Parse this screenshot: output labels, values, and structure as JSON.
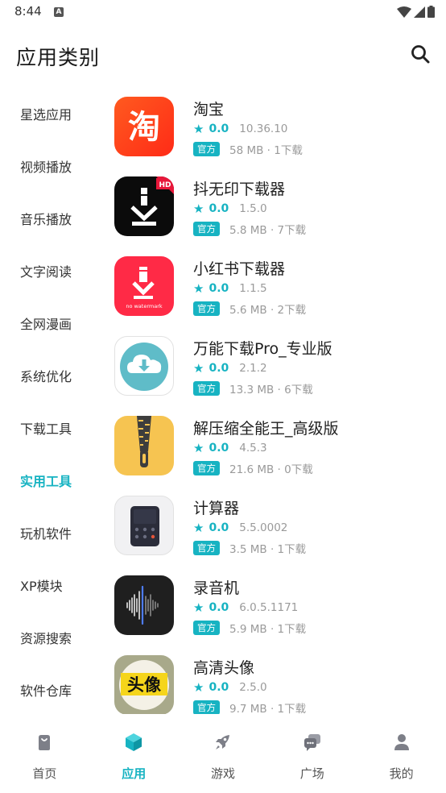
{
  "status_bar": {
    "time": "8:44",
    "notification_icon": "A"
  },
  "header": {
    "title": "应用类别",
    "search_icon": "search-icon"
  },
  "categories": [
    {
      "label": "星选应用",
      "active": false
    },
    {
      "label": "视频播放",
      "active": false
    },
    {
      "label": "音乐播放",
      "active": false
    },
    {
      "label": "文字阅读",
      "active": false
    },
    {
      "label": "全网漫画",
      "active": false
    },
    {
      "label": "系统优化",
      "active": false
    },
    {
      "label": "下载工具",
      "active": false
    },
    {
      "label": "实用工具",
      "active": true
    },
    {
      "label": "玩机软件",
      "active": false
    },
    {
      "label": "XP模块",
      "active": false
    },
    {
      "label": "资源搜索",
      "active": false
    },
    {
      "label": "软件仓库",
      "active": false
    }
  ],
  "apps": [
    {
      "name": "淘宝",
      "rating": "0.0",
      "version": "10.36.10",
      "badge": "官方",
      "meta": "58 MB · 1下载",
      "icon_text": "淘",
      "icon_extra": ""
    },
    {
      "name": "抖无印下载器",
      "rating": "0.0",
      "version": "1.5.0",
      "badge": "官方",
      "meta": "5.8 MB · 7下载",
      "icon_text": "",
      "icon_extra": "HD"
    },
    {
      "name": "小红书下载器",
      "rating": "0.0",
      "version": "1.1.5",
      "badge": "官方",
      "meta": "5.6 MB · 2下载",
      "icon_text": "",
      "icon_extra": "no watermark"
    },
    {
      "name": "万能下载Pro_专业版",
      "rating": "0.0",
      "version": "2.1.2",
      "badge": "官方",
      "meta": "13.3 MB · 6下载",
      "icon_text": "",
      "icon_extra": ""
    },
    {
      "name": "解压缩全能王_高级版",
      "rating": "0.0",
      "version": "4.5.3",
      "badge": "官方",
      "meta": "21.6 MB · 0下载",
      "icon_text": "",
      "icon_extra": ""
    },
    {
      "name": "计算器",
      "rating": "0.0",
      "version": "5.5.0002",
      "badge": "官方",
      "meta": "3.5 MB · 1下载",
      "icon_text": "",
      "icon_extra": ""
    },
    {
      "name": "录音机",
      "rating": "0.0",
      "version": "6.0.5.1171",
      "badge": "官方",
      "meta": "5.9 MB · 1下载",
      "icon_text": "",
      "icon_extra": ""
    },
    {
      "name": "高清头像",
      "rating": "0.0",
      "version": "2.5.0",
      "badge": "官方",
      "meta": "9.7 MB · 1下载",
      "icon_text": "头像",
      "icon_extra": ""
    }
  ],
  "bottom_nav": [
    {
      "label": "首页",
      "icon": "home-bag-icon",
      "active": false
    },
    {
      "label": "应用",
      "icon": "app-cube-icon",
      "active": true
    },
    {
      "label": "游戏",
      "icon": "rocket-icon",
      "active": false
    },
    {
      "label": "广场",
      "icon": "chat-bubbles-icon",
      "active": false
    },
    {
      "label": "我的",
      "icon": "profile-icon",
      "active": false
    }
  ],
  "colors": {
    "accent": "#17b3c2",
    "accent_light": "#e6f6f7"
  }
}
